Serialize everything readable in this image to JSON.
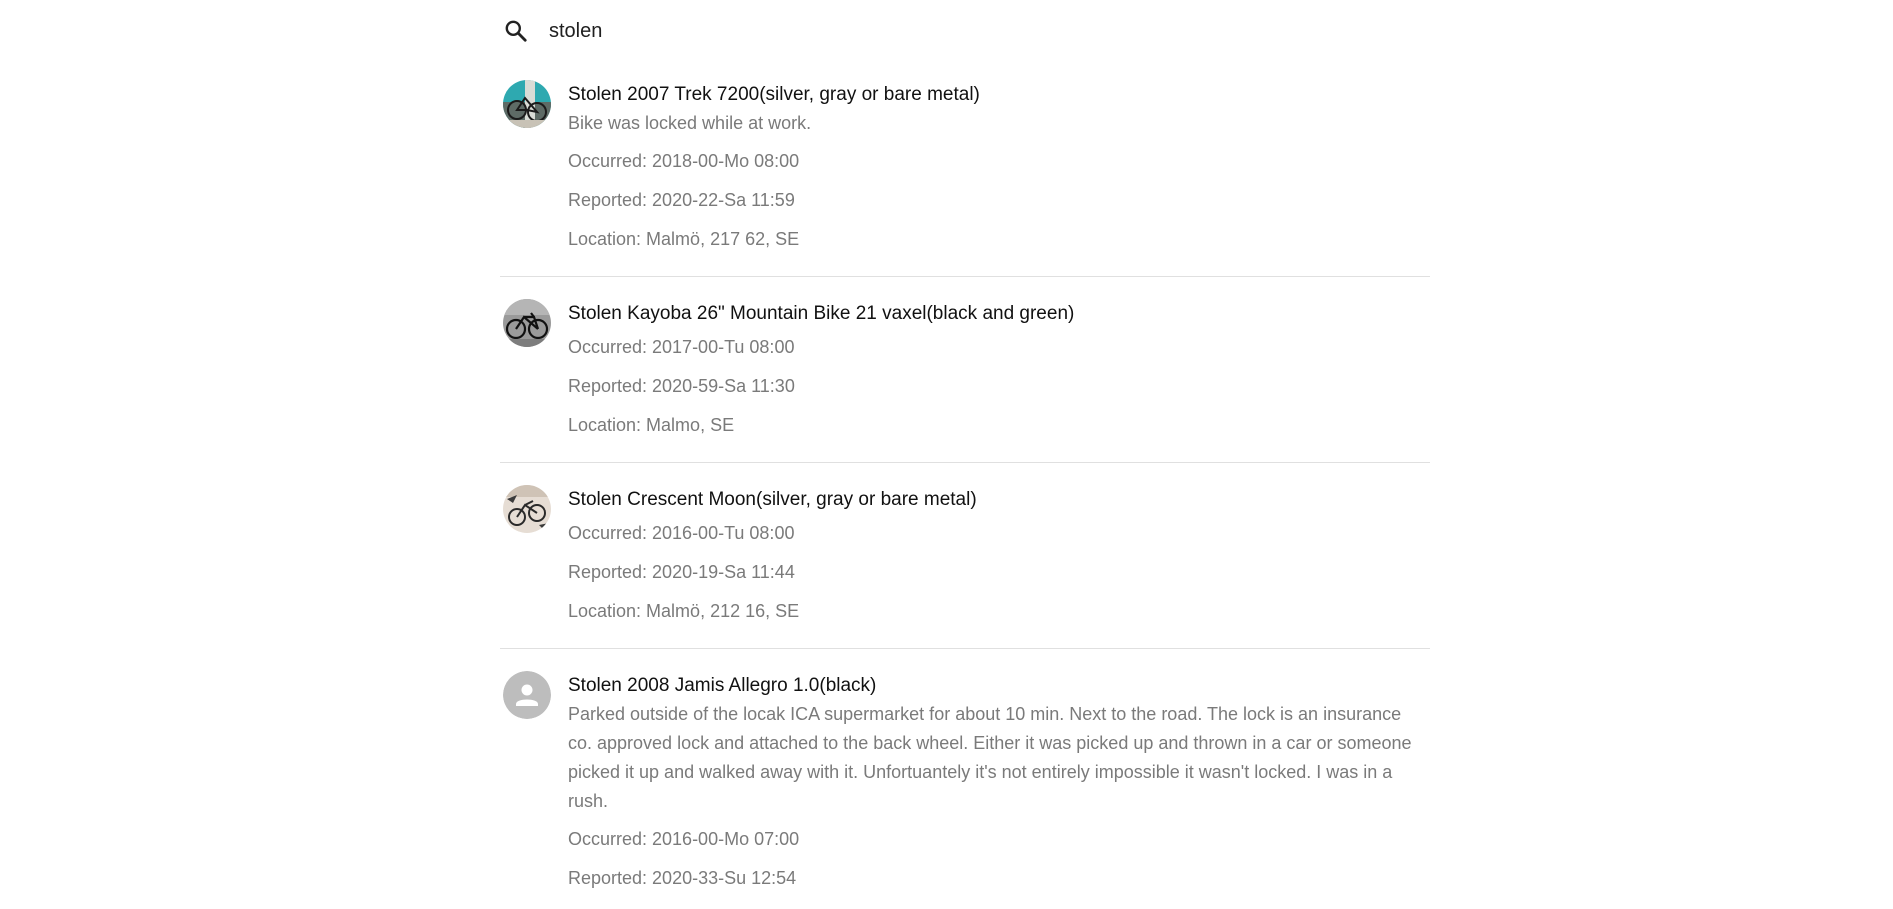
{
  "search": {
    "value": "stolen",
    "icon": "search-icon"
  },
  "reports": [
    {
      "title": "Stolen 2007 Trek 7200(silver, gray or bare metal)",
      "description": "Bike was locked while at work.",
      "occurred": "Occurred: 2018-00-Mo 08:00",
      "reported": "Reported: 2020-22-Sa 11:59",
      "location": "Location: Malmö, 217 62, SE",
      "avatar": "bike-photo-teal"
    },
    {
      "title": "Stolen Kayoba 26\" Mountain Bike 21 vaxel(black and green)",
      "occurred": "Occurred: 2017-00-Tu 08:00",
      "reported": "Reported: 2020-59-Sa 11:30",
      "location": "Location: Malmo, SE",
      "avatar": "bike-photo-gray"
    },
    {
      "title": "Stolen Crescent Moon(silver, gray or bare metal)",
      "occurred": "Occurred: 2016-00-Tu 08:00",
      "reported": "Reported: 2020-19-Sa 11:44",
      "location": "Location: Malmö, 212 16, SE",
      "avatar": "bike-photo-beige"
    },
    {
      "title": "Stolen 2008 Jamis Allegro 1.0(black)",
      "description": "Parked outside of the locak ICA supermarket for about 10 min. Next to the road. The lock is an insurance co. approved lock and attached to the back wheel. Either it was picked up and thrown in a car or someone picked it up and walked away with it. Unfortuantely it's not entirely impossible it wasn't locked. I was in a rush.",
      "occurred": "Occurred: 2016-00-Mo 07:00",
      "reported": "Reported: 2020-33-Su 12:54",
      "avatar": "person-icon"
    }
  ]
}
